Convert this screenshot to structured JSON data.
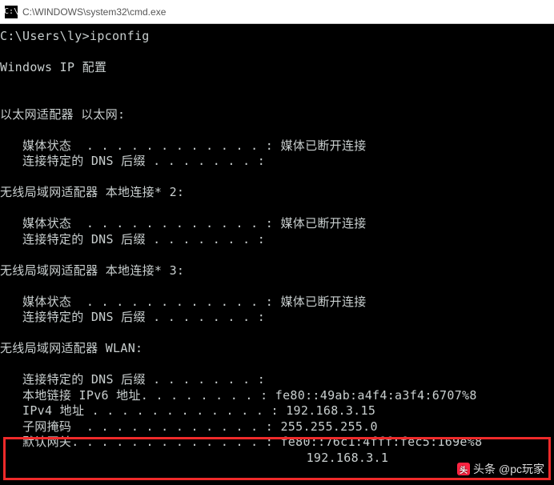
{
  "window": {
    "icon_glyph": "C:\\",
    "title": "C:\\WINDOWS\\system32\\cmd.exe"
  },
  "prompt": {
    "path": "C:\\Users\\ly>",
    "command": "ipconfig"
  },
  "header_line": "Windows IP 配置",
  "adapters": [
    {
      "title": "以太网适配器 以太网:",
      "rows": [
        {
          "label": "媒体状态",
          "dots": "  . . . . . . . . . . . . :",
          "value": " 媒体已断开连接"
        },
        {
          "label": "连接特定的 DNS 后缀",
          "dots": " . . . . . . . :",
          "value": ""
        }
      ]
    },
    {
      "title": "无线局域网适配器 本地连接* 2:",
      "rows": [
        {
          "label": "媒体状态",
          "dots": "  . . . . . . . . . . . . :",
          "value": " 媒体已断开连接"
        },
        {
          "label": "连接特定的 DNS 后缀",
          "dots": " . . . . . . . :",
          "value": ""
        }
      ]
    },
    {
      "title": "无线局域网适配器 本地连接* 3:",
      "rows": [
        {
          "label": "媒体状态",
          "dots": "  . . . . . . . . . . . . :",
          "value": " 媒体已断开连接"
        },
        {
          "label": "连接特定的 DNS 后缀",
          "dots": " . . . . . . . :",
          "value": ""
        }
      ]
    },
    {
      "title": "无线局域网适配器 WLAN:",
      "rows": [
        {
          "label": "连接特定的 DNS 后缀",
          "dots": " . . . . . . . :",
          "value": ""
        },
        {
          "label": "本地链接 IPv6 地址",
          "dots": ". . . . . . . . :",
          "value": " fe80::49ab:a4f4:a3f4:6707%8"
        },
        {
          "label": "IPv4 地址",
          "dots": " . . . . . . . . . . . . :",
          "value": " 192.168.3.15"
        },
        {
          "label": "子网掩码",
          "dots": "  . . . . . . . . . . . . :",
          "value": " 255.255.255.0"
        },
        {
          "label": "默认网关",
          "dots": ". . . . . . . . . . . . . :",
          "value": " fe80::76c1:4fff:fec5:169e%8"
        },
        {
          "label": "",
          "dots": "                                      ",
          "value": "192.168.3.1"
        }
      ]
    }
  ],
  "watermark": {
    "prefix": "头条",
    "handle": "@pc玩家"
  }
}
